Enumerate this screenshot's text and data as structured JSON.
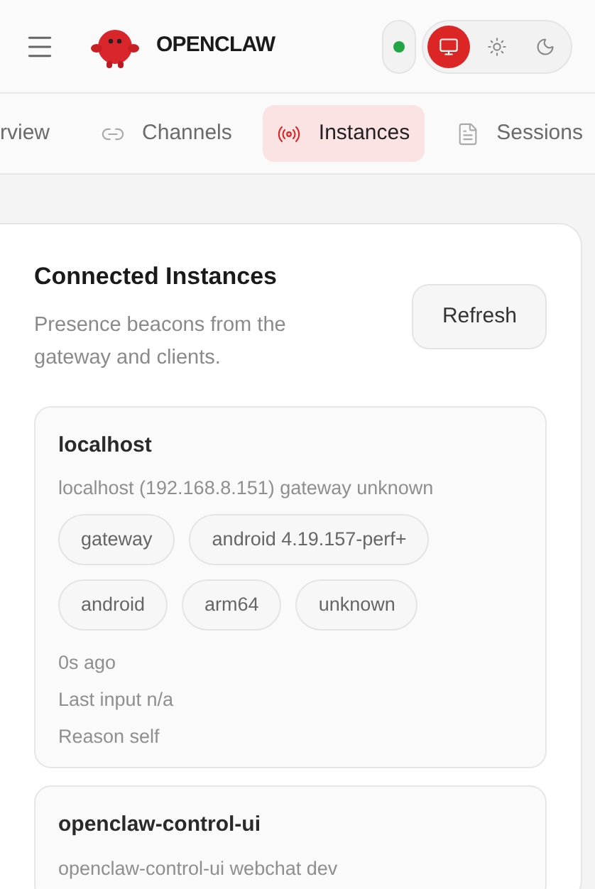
{
  "header": {
    "brand": "OPENCLAW",
    "connected": true,
    "themes": [
      {
        "kind": "system",
        "selected": true
      },
      {
        "kind": "light",
        "selected": false
      },
      {
        "kind": "dark",
        "selected": false
      }
    ]
  },
  "tabs": [
    {
      "label": "rview",
      "kind": "overview",
      "selected": false
    },
    {
      "label": "Channels",
      "kind": "channels",
      "selected": false
    },
    {
      "label": "Instances",
      "kind": "instances",
      "selected": true
    },
    {
      "label": "Sessions",
      "kind": "sessions",
      "selected": false
    }
  ],
  "panel": {
    "title": "Connected Instances",
    "subtitle": "Presence beacons from the gateway and clients.",
    "action": "Refresh",
    "instances": [
      {
        "name": "localhost",
        "detail": "localhost (192.168.8.151) gateway unknown",
        "tags": [
          "gateway",
          "android 4.19.157-perf+",
          "android",
          "arm64",
          "unknown"
        ],
        "meta": [
          "0s ago",
          "Last input n/a",
          "Reason self"
        ]
      },
      {
        "name": "openclaw-control-ui",
        "detail": "openclaw-control-ui webchat dev"
      }
    ]
  }
}
